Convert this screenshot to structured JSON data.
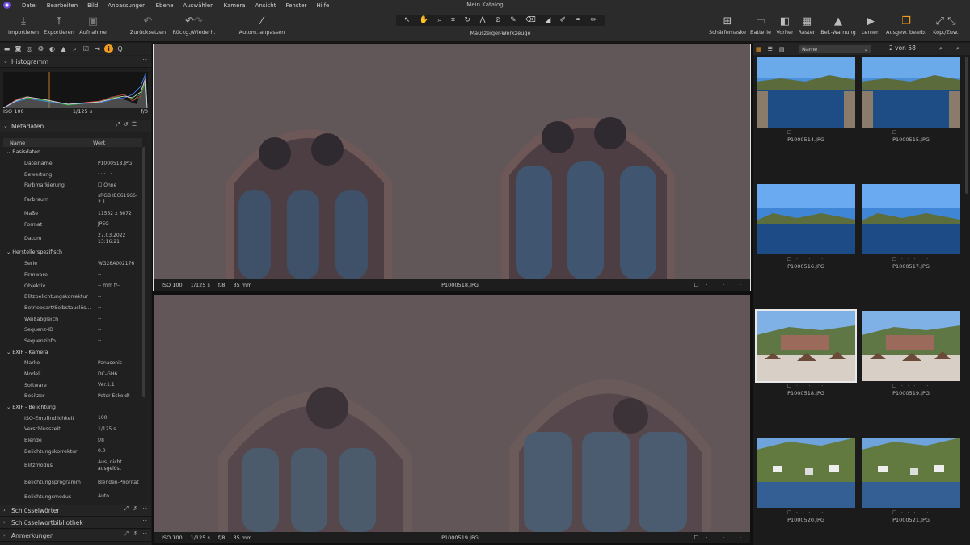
{
  "menu": {
    "items": [
      "Datei",
      "Bearbeiten",
      "Bild",
      "Anpassungen",
      "Ebene",
      "Auswählen",
      "Kamera",
      "Ansicht",
      "Fenster",
      "Hilfe"
    ],
    "title": "Mein Katalog"
  },
  "toolbar": {
    "left": [
      {
        "label": "Importieren",
        "icon": "download-icon"
      },
      {
        "label": "Exportieren",
        "icon": "upload-icon"
      },
      {
        "label": "Aufnahme",
        "icon": "camera-icon"
      }
    ],
    "history": [
      {
        "label": "Zurücksetzen",
        "icon": "reset-icon"
      },
      {
        "label": "Rückg./Wiederh.",
        "icon": "undo-icon"
      }
    ],
    "auto": {
      "label": "Autom. anpassen",
      "icon": "magic-wand-icon"
    },
    "cursor_tools_label": "Mauszeiger-Werkzeuge",
    "right": [
      {
        "label": "Schärfemaske",
        "icon": "focus-mask-icon"
      },
      {
        "label": "Batterie",
        "icon": "battery-icon"
      },
      {
        "label": "Vorher",
        "icon": "before-icon"
      },
      {
        "label": "Raster",
        "icon": "grid-icon"
      },
      {
        "label": "Bel.-Warnung",
        "icon": "warning-icon"
      },
      {
        "label": "Lernen",
        "icon": "play-icon"
      },
      {
        "label": "Ausgew. bearb.",
        "icon": "edit-selected-icon"
      },
      {
        "label": "Kop./Zuw.",
        "icon": "copy-apply-icon"
      }
    ]
  },
  "histogram": {
    "title": "Histogramm",
    "iso": "ISO 100",
    "shutter": "1/125 s",
    "aperture": "f/0"
  },
  "metadata": {
    "title": "Metadaten",
    "col_name": "Name",
    "col_value": "Wert",
    "rows": [
      {
        "g": true,
        "k": "Basisdaten"
      },
      {
        "k": "Dateiname",
        "v": "P1000518.JPG"
      },
      {
        "k": "Bewertung",
        "v": "· · · · ·"
      },
      {
        "k": "Farbmarkierung",
        "v": "☐ Ohne"
      },
      {
        "k": "Farbraum",
        "v": "sRGB IEC61966-2.1",
        "h": 2
      },
      {
        "k": "Maße",
        "v": "11552 x 8672"
      },
      {
        "k": "Format",
        "v": "JPEG"
      },
      {
        "k": "Datum",
        "v": "27.03.2022 13:16:21",
        "h": 2
      },
      {
        "g": true,
        "k": "Herstellerspezifisch"
      },
      {
        "k": "Serie",
        "v": "WG28A002176"
      },
      {
        "k": "Firmware",
        "v": "--"
      },
      {
        "k": "Objektiv",
        "v": "-- mm f/--"
      },
      {
        "k": "Blitzbelichtungskorrektur",
        "v": "--"
      },
      {
        "k": "Betriebsart/Selbstauslös...",
        "v": "--"
      },
      {
        "k": "Weißabgleich",
        "v": "--"
      },
      {
        "k": "Sequenz-ID",
        "v": "--"
      },
      {
        "k": "Sequenzinfo",
        "v": "--"
      },
      {
        "g": true,
        "k": "EXIF - Kamera"
      },
      {
        "k": "Marke",
        "v": "Panasonic"
      },
      {
        "k": "Modell",
        "v": "DC-GH6"
      },
      {
        "k": "Software",
        "v": "Ver.1.1"
      },
      {
        "k": "Besitzer",
        "v": "Peter Eckoldt"
      },
      {
        "g": true,
        "k": "EXIF - Belichtung"
      },
      {
        "k": "ISO-Empfindlichkeit",
        "v": "100"
      },
      {
        "k": "Verschlusszeit",
        "v": "1/125 s"
      },
      {
        "k": "Blende",
        "v": "f/8"
      },
      {
        "k": "Belichtungskorrektur",
        "v": "0.0"
      },
      {
        "k": "Blitzmodus",
        "v": "Aus, nicht ausgelöst",
        "h": 2
      },
      {
        "k": "Belichtungsprogramm",
        "v": "Blenden-Priorität",
        "h": 2
      },
      {
        "k": "Belichtungsmodus",
        "v": "Auto"
      }
    ]
  },
  "sections": {
    "keywords": "Schlüsselwörter",
    "keyword_library": "Schlüsselwortbibliothek",
    "annotations": "Anmerkungen"
  },
  "viewer": {
    "top": {
      "iso": "ISO 100",
      "shutter": "1/125 s",
      "aperture": "f/8",
      "focal": "35 mm",
      "filename": "P1000518.JPG",
      "rating": "☐ · · · · ·"
    },
    "bottom": {
      "iso": "ISO 100",
      "shutter": "1/125 s",
      "aperture": "f/8",
      "focal": "35 mm",
      "filename": "P1000519.JPG",
      "rating": "☐ · · · · ·"
    }
  },
  "browser": {
    "sort": "Name",
    "count": "2 von 58",
    "thumbs": [
      {
        "name": "P1000514.JPG",
        "scene": "river",
        "stars": "☐ · · · · ·"
      },
      {
        "name": "P1000515.JPG",
        "scene": "river",
        "stars": "☐ · · · · ·"
      },
      {
        "name": "P1000516.JPG",
        "scene": "river2",
        "stars": "☐ · · · · ·"
      },
      {
        "name": "P1000517.JPG",
        "scene": "river2",
        "stars": "☐ · · · · ·"
      },
      {
        "name": "P1000518.JPG",
        "scene": "castle",
        "stars": "☐ · · · · ·",
        "selected": true
      },
      {
        "name": "P1000519.JPG",
        "scene": "castle",
        "stars": "☐ · · · · ·"
      },
      {
        "name": "P1000520.JPG",
        "scene": "town",
        "stars": "☐ · · · · ·"
      },
      {
        "name": "P1000521.JPG",
        "scene": "town",
        "stars": "☐ · · · · ·"
      }
    ]
  }
}
